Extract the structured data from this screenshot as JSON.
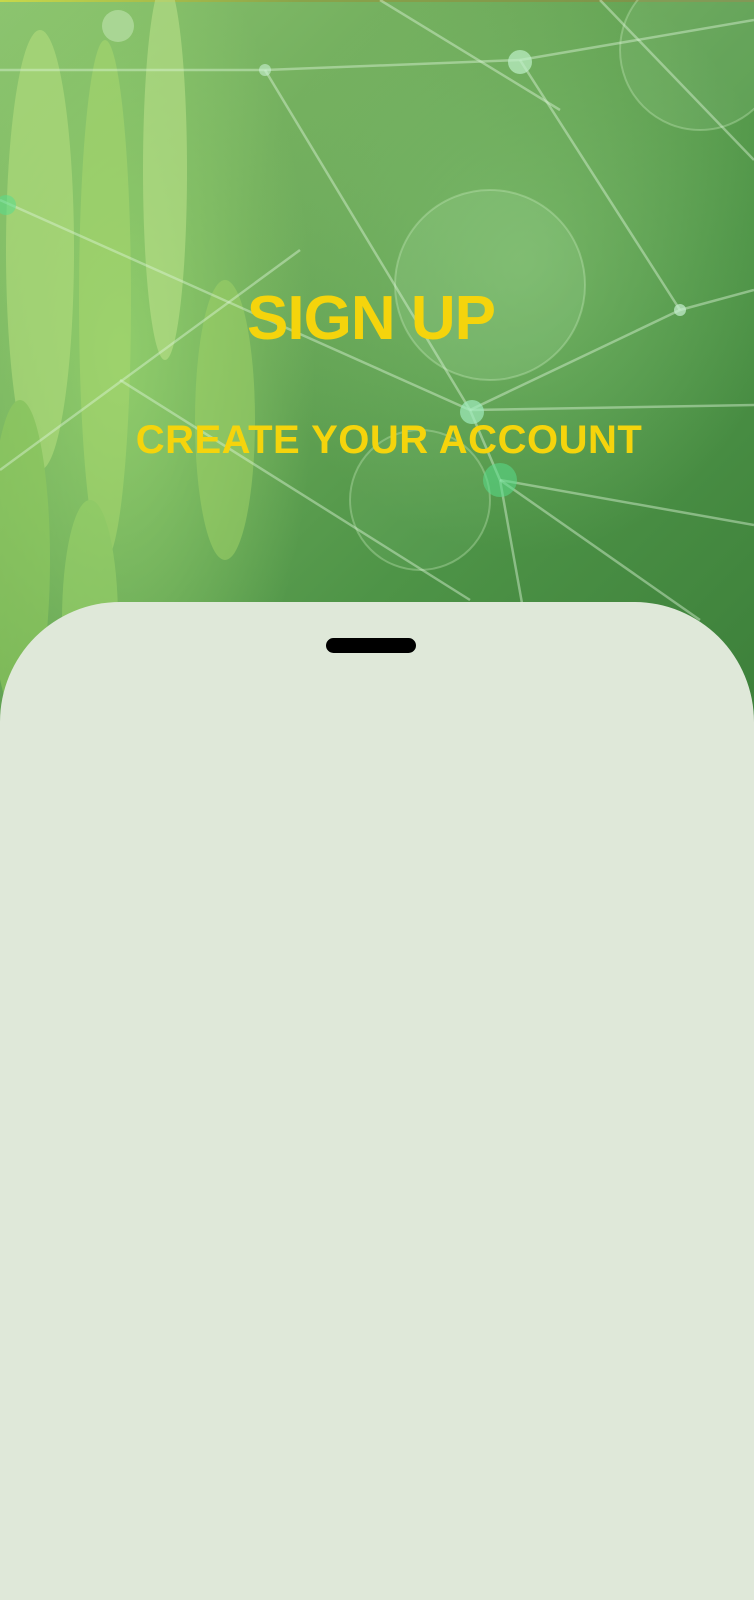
{
  "header": {
    "title": "SIGN UP",
    "subtitle": "CREATE YOUR ACCOUNT"
  },
  "colors": {
    "accent": "#f5d40c",
    "hero_green": "#5a9c4f",
    "sheet_background": "#dfe8d9",
    "handle": "#000000"
  },
  "background_image": "green-plant-network-photo"
}
